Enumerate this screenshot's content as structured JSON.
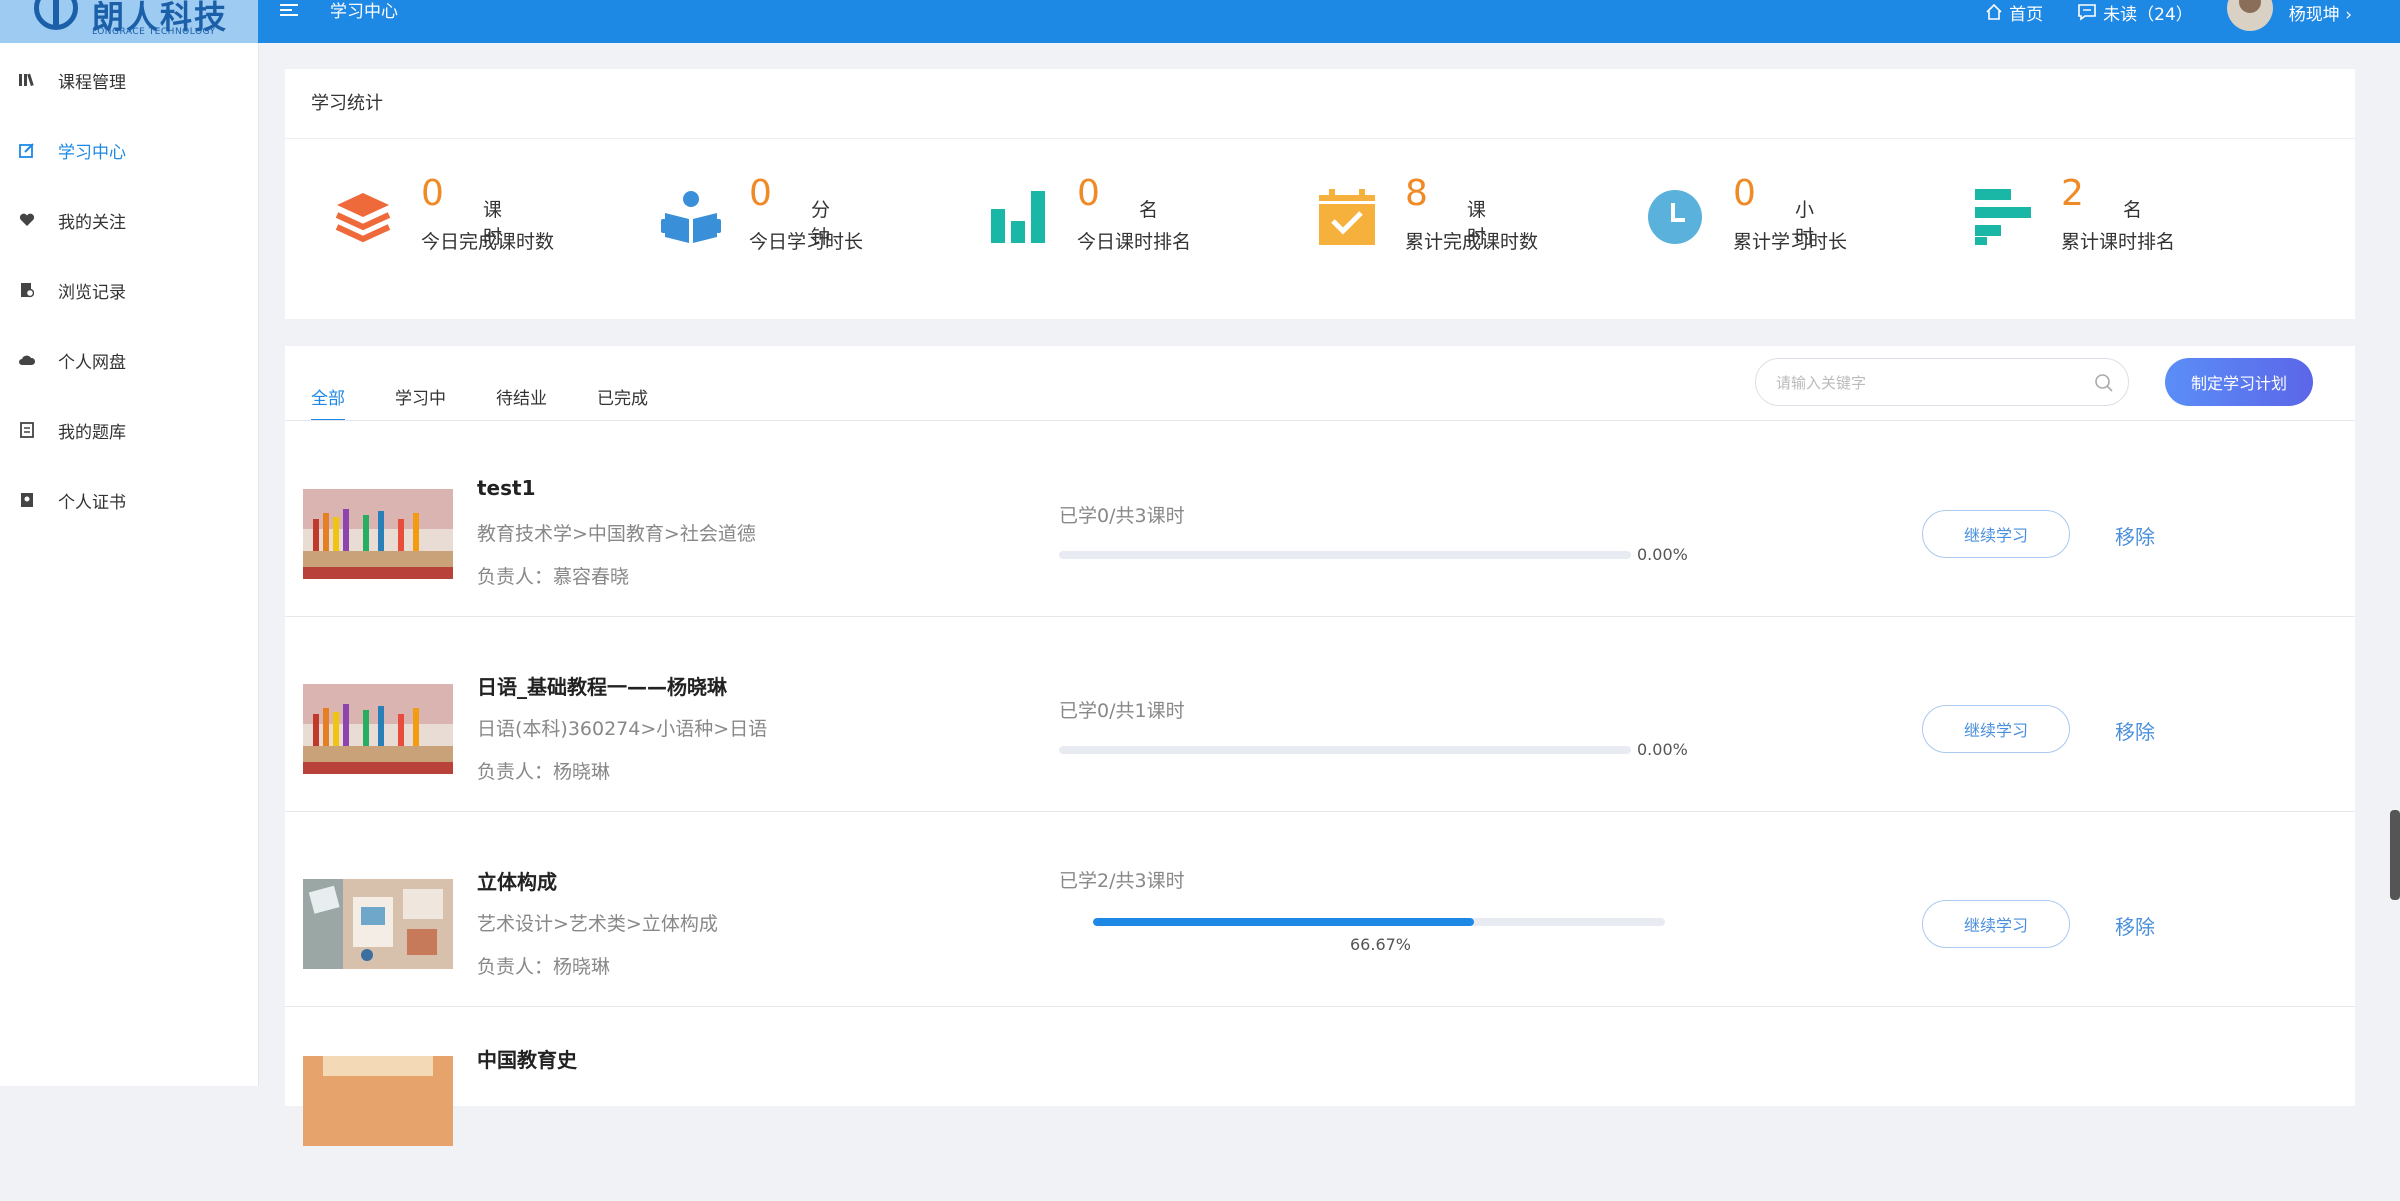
{
  "header": {
    "logo_text": "朗人科技",
    "logo_sub": "LONGRACE TECHNOLOGY",
    "breadcrumb": "学习中心",
    "home_label": "首页",
    "unread_label": "未读（24）",
    "user_name": "杨现坤 ›"
  },
  "sidebar": {
    "items": [
      {
        "label": "课程管理",
        "icon": "books-icon"
      },
      {
        "label": "学习中心",
        "icon": "edit-icon"
      },
      {
        "label": "我的关注",
        "icon": "heart-icon"
      },
      {
        "label": "浏览记录",
        "icon": "history-icon"
      },
      {
        "label": "个人网盘",
        "icon": "cloud-icon"
      },
      {
        "label": "我的题库",
        "icon": "question-bank-icon"
      },
      {
        "label": "个人证书",
        "icon": "certificate-icon"
      }
    ],
    "active_index": 1
  },
  "stats": {
    "title": "学习统计",
    "items": [
      {
        "value": "0",
        "unit": "课时",
        "label": "今日完成课时数",
        "icon": "layers-icon"
      },
      {
        "value": "0",
        "unit": "分钟",
        "label": "今日学习时长",
        "icon": "reader-icon"
      },
      {
        "value": "0",
        "unit": "名",
        "label": "今日课时排名",
        "icon": "bar-chart-icon"
      },
      {
        "value": "8",
        "unit": "课时",
        "label": "累计完成课时数",
        "icon": "calendar-check-icon"
      },
      {
        "value": "0",
        "unit": "小时",
        "label": "累计学习时长",
        "icon": "clock-icon"
      },
      {
        "value": "2",
        "unit": "名",
        "label": "累计课时排名",
        "icon": "horizontal-bars-icon"
      }
    ]
  },
  "tabs": [
    "全部",
    "学习中",
    "待结业",
    "已完成"
  ],
  "search": {
    "placeholder": "请输入关键字"
  },
  "plan_button": "制定学习计划",
  "courses": [
    {
      "title": "test1",
      "path": "教育技术学>中国教育>社会道德",
      "owner": "负责人：慕容春晓",
      "progress_text": "已学0/共3课时",
      "percent": "0.00%",
      "fraction": 0,
      "continue": "继续学习",
      "remove": "移除"
    },
    {
      "title": "日语_基础教程一——杨晓琳",
      "path": "日语(本科)360274>小语种>日语",
      "owner": "负责人：杨晓琳",
      "progress_text": "已学0/共1课时",
      "percent": "0.00%",
      "fraction": 0,
      "continue": "继续学习",
      "remove": "移除"
    },
    {
      "title": "立体构成",
      "path": "艺术设计>艺术类>立体构成",
      "owner": "负责人：杨晓琳",
      "progress_text": "已学2/共3课时",
      "percent": "66.67%",
      "fraction": 0.6667,
      "continue": "继续学习",
      "remove": "移除"
    },
    {
      "title": "中国教育史"
    }
  ],
  "colors": {
    "primary": "#1e88e5",
    "accent_orange": "#ef8a27",
    "teal": "#1bb7a6",
    "sidebar_active": "#1e88e5"
  }
}
